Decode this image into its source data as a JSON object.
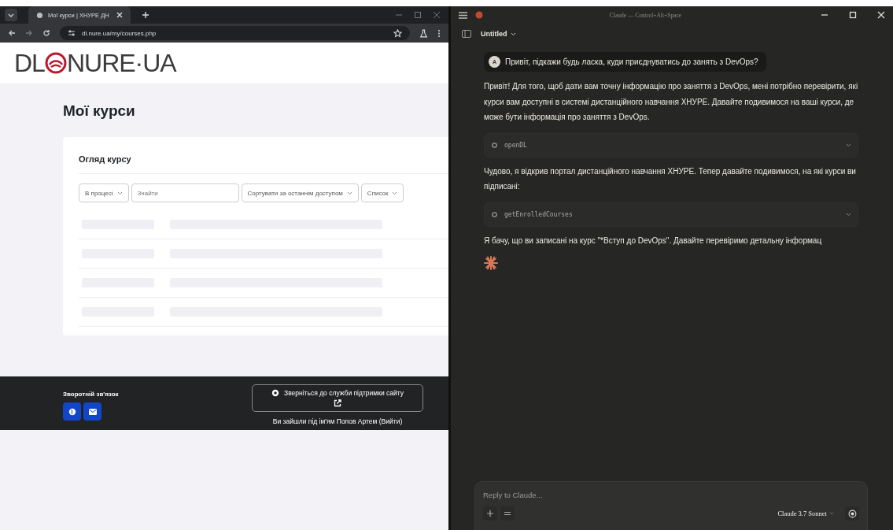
{
  "browser": {
    "tabs": [
      {
        "title": "Мої курси | ХНУРЕ ДН",
        "selected": true
      }
    ],
    "url": "dl.nure.ua/my/courses.php",
    "logo": {
      "left": "DL",
      "right": "NURE·UA"
    },
    "page_title": "Мої курси",
    "card_title": "Огляд курсу",
    "filters": [
      {
        "kind": "select",
        "value": "В процесі"
      },
      {
        "kind": "search",
        "placeholder": "Знайти"
      },
      {
        "kind": "select",
        "value": "Сортувати за останнім доступом"
      },
      {
        "kind": "select",
        "value": "Список"
      }
    ],
    "footer": {
      "heading": "Зворотній зв'язок",
      "support_button": "Зверніться до служби підтримки сайту",
      "login_text": "Ви зайшли під ім'ям Попов Артем (Вийти)"
    }
  },
  "claude": {
    "title": "Claude — Control+Alt+Space",
    "conversation_title": "Untitled",
    "messages": [
      {
        "kind": "user",
        "avatar": "A",
        "text": "Привіт, підкажи будь ласка, куди приєднуватись до занять з DevOps?"
      },
      {
        "kind": "assistant",
        "text": "Привіт! Для того, щоб дати вам точну інформацію про заняття з DevOps, мені потрібно перевірити, які курси вам доступні в системі дистанційного навчання ХНУРЕ. Давайте подивимося на ваші курси, де може бути інформація про заняття з DevOps."
      },
      {
        "kind": "tool",
        "name": "openDL"
      },
      {
        "kind": "assistant",
        "text": "Чудово, я відкрив портал дистанційного навчання ХНУРЕ. Тепер давайте подивимося, на які курси ви підписані:"
      },
      {
        "kind": "tool",
        "name": "getEnrolledCourses"
      },
      {
        "kind": "assistant",
        "text": "Я бачу, що ви записані на курс \"*Вступ до DevOps\". Давайте перевіримо детальну інформац"
      },
      {
        "kind": "spinner"
      }
    ],
    "input": {
      "placeholder": "Reply to Claude..."
    },
    "model": "Claude 3.7 Sonnet"
  }
}
